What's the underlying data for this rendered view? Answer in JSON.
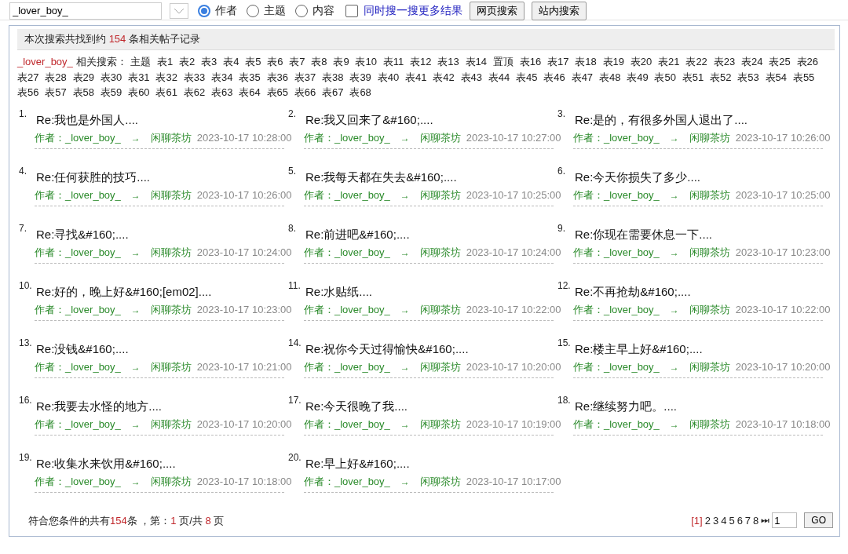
{
  "search": {
    "value": "_lover_boy_",
    "options": [
      {
        "label": "作者",
        "selected": true
      },
      {
        "label": "主题",
        "selected": false
      },
      {
        "label": "内容",
        "selected": false
      }
    ],
    "more": {
      "label": "同时搜一搜更多结果",
      "checked": false
    },
    "buttons": [
      "网页搜索",
      "站内搜索"
    ]
  },
  "summary": {
    "before": "本次搜索共找到约 ",
    "count": "154",
    "after": " 条相关帖子记录"
  },
  "related": {
    "keyword": "_lover_boy_",
    "label": "相关搜索：",
    "tags": [
      "主题",
      "表1",
      "表2",
      "表3",
      "表4",
      "表5",
      "表6",
      "表7",
      "表8",
      "表9",
      "表10",
      "表11",
      "表12",
      "表13",
      "表14",
      "置顶",
      "表16",
      "表17",
      "表18",
      "表19",
      "表20",
      "表21",
      "表22",
      "表23",
      "表24",
      "表25",
      "表26",
      "表27",
      "表28",
      "表29",
      "表30",
      "表31",
      "表32",
      "表33",
      "表34",
      "表35",
      "表36",
      "表37",
      "表38",
      "表39",
      "表40",
      "表41",
      "表42",
      "表43",
      "表44",
      "表45",
      "表46",
      "表47",
      "表48",
      "表49",
      "表50",
      "表51",
      "表52",
      "表53",
      "表54",
      "表55",
      "表56",
      "表57",
      "表58",
      "表59",
      "表60",
      "表61",
      "表62",
      "表63",
      "表64",
      "表65",
      "表66",
      "表67",
      "表68"
    ]
  },
  "posts": [
    {
      "index": "1.",
      "title": "Re:我也是外国人....",
      "author": "作者：_lover_boy_",
      "arrow": "→",
      "forum": "闲聊茶坊",
      "time": "2023-10-17 10:28:00"
    },
    {
      "index": "2.",
      "title": "Re:我又回来了&#160;....",
      "author": "作者：_lover_boy_",
      "arrow": "→",
      "forum": "闲聊茶坊",
      "time": "2023-10-17 10:27:00"
    },
    {
      "index": "3.",
      "title": "Re:是的，有很多外国人退出了....",
      "author": "作者：_lover_boy_",
      "arrow": "→",
      "forum": "闲聊茶坊",
      "time": "2023-10-17 10:26:00"
    },
    {
      "index": "4.",
      "title": "Re:任何获胜的技巧....",
      "author": "作者：_lover_boy_",
      "arrow": "→",
      "forum": "闲聊茶坊",
      "time": "2023-10-17 10:26:00"
    },
    {
      "index": "5.",
      "title": "Re:我每天都在失去&#160;....",
      "author": "作者：_lover_boy_",
      "arrow": "→",
      "forum": "闲聊茶坊",
      "time": "2023-10-17 10:25:00"
    },
    {
      "index": "6.",
      "title": "Re:今天你损失了多少....",
      "author": "作者：_lover_boy_",
      "arrow": "→",
      "forum": "闲聊茶坊",
      "time": "2023-10-17 10:25:00"
    },
    {
      "index": "7.",
      "title": "Re:寻找&#160;....",
      "author": "作者：_lover_boy_",
      "arrow": "→",
      "forum": "闲聊茶坊",
      "time": "2023-10-17 10:24:00"
    },
    {
      "index": "8.",
      "title": "Re:前进吧&#160;....",
      "author": "作者：_lover_boy_",
      "arrow": "→",
      "forum": "闲聊茶坊",
      "time": "2023-10-17 10:24:00"
    },
    {
      "index": "9.",
      "title": "Re:你现在需要休息一下....",
      "author": "作者：_lover_boy_",
      "arrow": "→",
      "forum": "闲聊茶坊",
      "time": "2023-10-17 10:23:00"
    },
    {
      "index": "10.",
      "title": "Re:好的，晚上好&#160;[em02]....",
      "author": "作者：_lover_boy_",
      "arrow": "→",
      "forum": "闲聊茶坊",
      "time": "2023-10-17 10:23:00"
    },
    {
      "index": "11.",
      "title": "Re:水贴纸....",
      "author": "作者：_lover_boy_",
      "arrow": "→",
      "forum": "闲聊茶坊",
      "time": "2023-10-17 10:22:00"
    },
    {
      "index": "12.",
      "title": "Re:不再抢劫&#160;....",
      "author": "作者：_lover_boy_",
      "arrow": "→",
      "forum": "闲聊茶坊",
      "time": "2023-10-17 10:22:00"
    },
    {
      "index": "13.",
      "title": "Re:没钱&#160;....",
      "author": "作者：_lover_boy_",
      "arrow": "→",
      "forum": "闲聊茶坊",
      "time": "2023-10-17 10:21:00"
    },
    {
      "index": "14.",
      "title": "Re:祝你今天过得愉快&#160;....",
      "author": "作者：_lover_boy_",
      "arrow": "→",
      "forum": "闲聊茶坊",
      "time": "2023-10-17 10:20:00"
    },
    {
      "index": "15.",
      "title": "Re:楼主早上好&#160;....",
      "author": "作者：_lover_boy_",
      "arrow": "→",
      "forum": "闲聊茶坊",
      "time": "2023-10-17 10:20:00"
    },
    {
      "index": "16.",
      "title": "Re:我要去水怪的地方....",
      "author": "作者：_lover_boy_",
      "arrow": "→",
      "forum": "闲聊茶坊",
      "time": "2023-10-17 10:20:00"
    },
    {
      "index": "17.",
      "title": "Re:今天很晚了我....",
      "author": "作者：_lover_boy_",
      "arrow": "→",
      "forum": "闲聊茶坊",
      "time": "2023-10-17 10:19:00"
    },
    {
      "index": "18.",
      "title": "Re:继续努力吧。....",
      "author": "作者：_lover_boy_",
      "arrow": "→",
      "forum": "闲聊茶坊",
      "time": "2023-10-17 10:18:00"
    },
    {
      "index": "19.",
      "title": "Re:收集水来饮用&#160;....",
      "author": "作者：_lover_boy_",
      "arrow": "→",
      "forum": "闲聊茶坊",
      "time": "2023-10-17 10:18:00"
    },
    {
      "index": "20.",
      "title": "Re:早上好&#160;....",
      "author": "作者：_lover_boy_",
      "arrow": "→",
      "forum": "闲聊茶坊",
      "time": "2023-10-17 10:17:00"
    }
  ],
  "footer": {
    "parts": [
      "符合您条件的共有",
      "154",
      "条 ，第：",
      "1",
      " 页/共 ",
      "8",
      " 页"
    ]
  },
  "pager": {
    "pages": [
      {
        "label": "[1]",
        "selected": true
      },
      {
        "label": "2",
        "selected": false
      },
      {
        "label": "3",
        "selected": false
      },
      {
        "label": "4",
        "selected": false
      },
      {
        "label": "5",
        "selected": false
      },
      {
        "label": "6",
        "selected": false
      },
      {
        "label": "7",
        "selected": false
      },
      {
        "label": "8",
        "selected": false
      }
    ],
    "arrow": "⏭",
    "page_value": "1",
    "go": "GO"
  }
}
